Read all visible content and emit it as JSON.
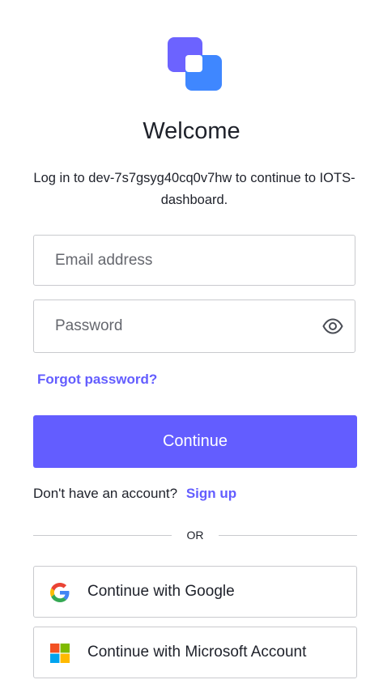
{
  "brand": {
    "logo_icon": "auth0-style-logo-icon",
    "colors": {
      "accent": "#635dff",
      "logo_back": "#6c63ff",
      "logo_front": "#3f87ff",
      "text": "#1e212a",
      "border": "#c9cace"
    }
  },
  "header": {
    "title": "Welcome",
    "subtitle": "Log in to dev-7s7gsyg40cq0v7hw to continue to IOTS-dashboard."
  },
  "form": {
    "email": {
      "placeholder": "Email address",
      "value": ""
    },
    "password": {
      "placeholder": "Password",
      "value": "",
      "toggle_icon": "eye-icon"
    },
    "forgot_label": "Forgot password?",
    "continue_label": "Continue"
  },
  "signup": {
    "prompt": "Don't have an account?",
    "link_label": "Sign up"
  },
  "divider": {
    "label": "OR"
  },
  "social": [
    {
      "label": "Continue with Google",
      "icon": "google-icon"
    },
    {
      "label": "Continue with Microsoft Account",
      "icon": "microsoft-icon"
    }
  ]
}
